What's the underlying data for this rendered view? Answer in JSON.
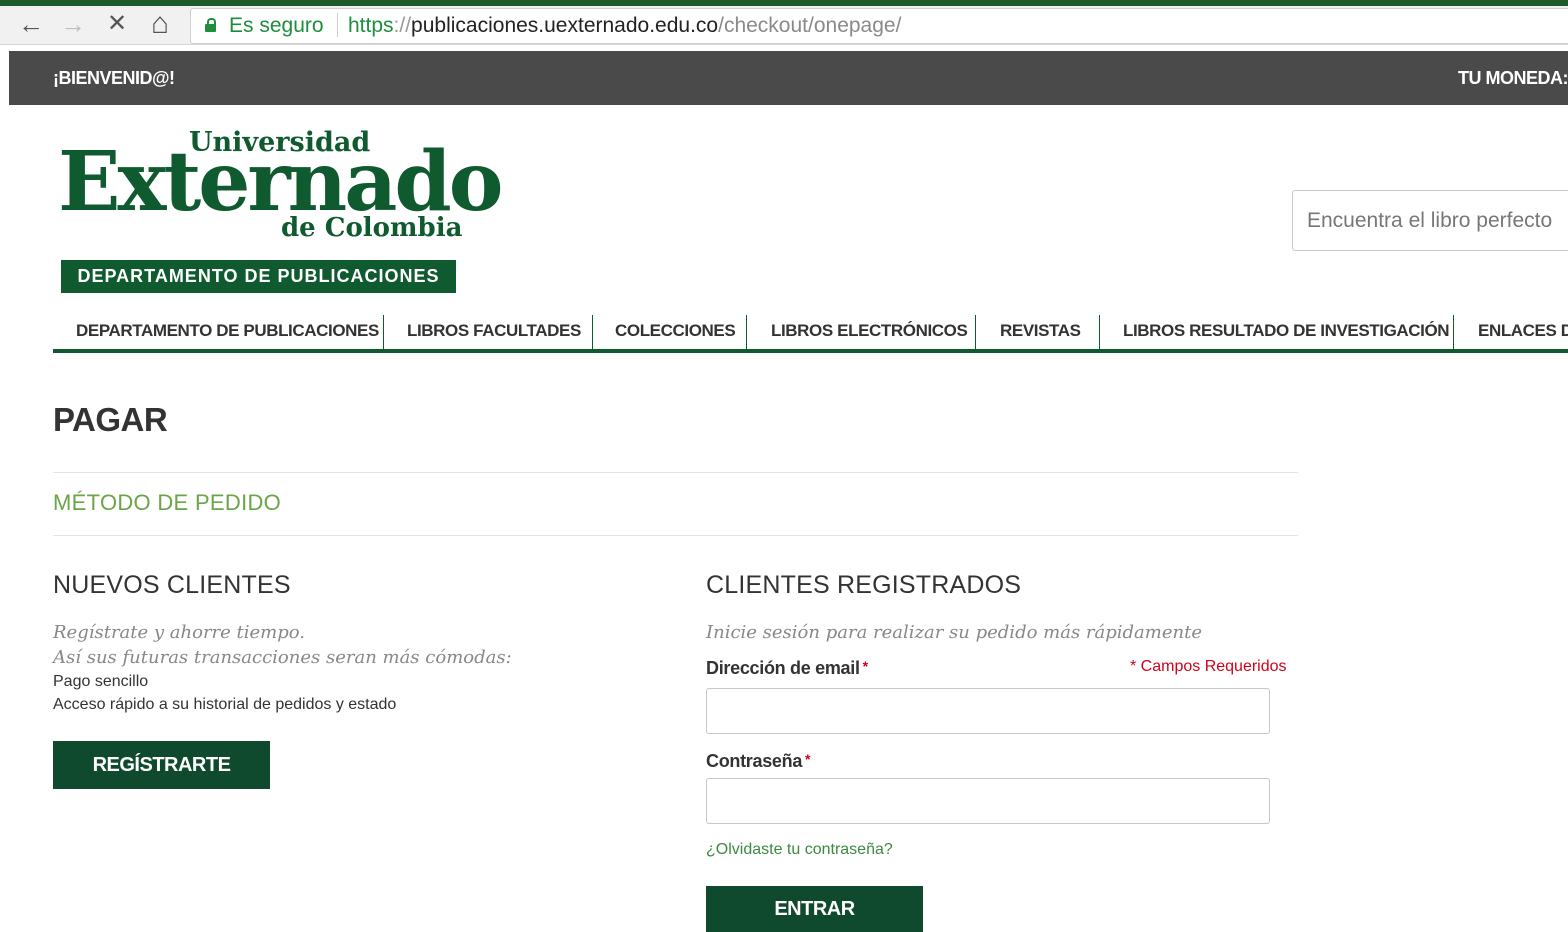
{
  "browser": {
    "back_icon": "←",
    "forward_icon": "→",
    "stop_icon": "✕",
    "home_icon": "⌂",
    "secure_label": "Es seguro",
    "url_protocol": "https",
    "url_slashes": "://",
    "url_host": "publicaciones.uexternado.edu.co",
    "url_path": "/checkout/onepage/"
  },
  "topbar": {
    "welcome": "¡BIENVENID@!",
    "currency_label": "TU MONEDA:"
  },
  "logo": {
    "line1": "Universidad",
    "line2": "Externado",
    "line3": "de Colombia",
    "band": "DEPARTAMENTO DE PUBLICACIONES"
  },
  "search": {
    "placeholder": "Encuentra el libro perfecto"
  },
  "nav": {
    "items": [
      "DEPARTAMENTO DE PUBLICACIONES",
      "LIBROS FACULTADES",
      "COLECCIONES",
      "LIBROS ELECTRÓNICOS",
      "REVISTAS",
      "LIBROS RESULTADO DE INVESTIGACIÓN",
      "ENLACES DE"
    ]
  },
  "page": {
    "title": "PAGAR",
    "section": "MÉTODO DE PEDIDO"
  },
  "new_customers": {
    "heading": "NUEVOS CLIENTES",
    "intro1": "Regístrate y ahorre tiempo.",
    "intro2": "Así sus futuras transacciones seran más cómodas:",
    "benefit1": "Pago sencillo",
    "benefit2": "Acceso rápido a su historial de pedidos y estado",
    "register_button": "REGÍSTRARTE"
  },
  "registered_customers": {
    "heading": "CLIENTES REGISTRADOS",
    "intro": "Inicie sesión para realizar su pedido más rápidamente",
    "email_label": "Dirección de email",
    "required_mark": "*",
    "required_note": "* Campos Requeridos",
    "email_value": "",
    "password_label": "Contraseña",
    "password_value": "",
    "forgot_link": "¿Olvidaste tu contraseña?",
    "login_button": "ENTRAR"
  },
  "colors": {
    "brand_green": "#0f5a2e",
    "accent_green": "#6aa548",
    "topbar_gray": "#4a4a4a",
    "required_red": "#d0021b"
  }
}
